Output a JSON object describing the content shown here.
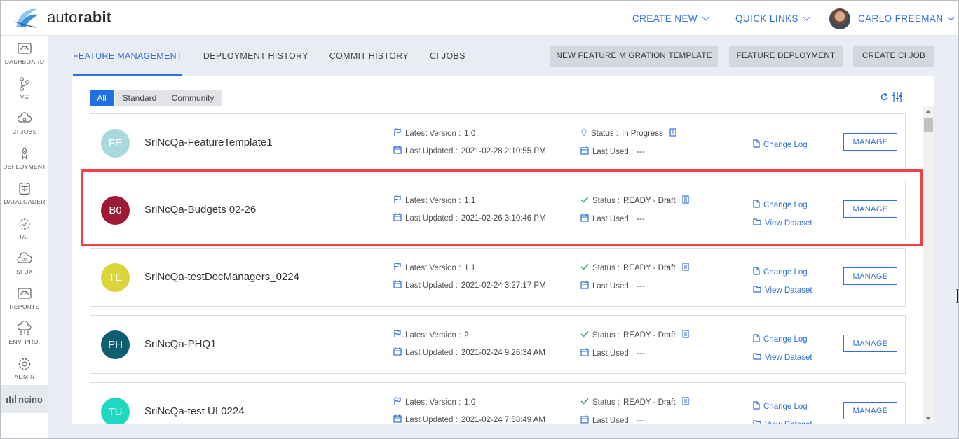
{
  "brand": {
    "prefix": "auto",
    "suffix": "rabit"
  },
  "header": {
    "create_new": "CREATE NEW",
    "quick_links": "QUICK LINKS",
    "user_name": "CARLO FREEMAN"
  },
  "sidebar": {
    "items": [
      {
        "label": "DASHBOARD",
        "icon": "dashboard-icon"
      },
      {
        "label": "VC",
        "icon": "vc-icon"
      },
      {
        "label": "CI JOBS",
        "icon": "ci-jobs-icon"
      },
      {
        "label": "DEPLOYMENT",
        "icon": "deployment-icon"
      },
      {
        "label": "DATALOADER",
        "icon": "dataloader-icon"
      },
      {
        "label": "TAF",
        "icon": "taf-icon"
      },
      {
        "label": "SFDX",
        "icon": "sfdx-icon"
      },
      {
        "label": "REPORTS",
        "icon": "reports-icon"
      },
      {
        "label": "ENV. PRO.",
        "icon": "env-pro-icon"
      },
      {
        "label": "ADMIN",
        "icon": "admin-icon"
      }
    ],
    "footer_logo": "ncino"
  },
  "tabs": [
    "FEATURE MANAGEMENT",
    "DEPLOYMENT HISTORY",
    "COMMIT HISTORY",
    "CI JOBS"
  ],
  "actions": {
    "new_template": "NEW FEATURE MIGRATION TEMPLATE",
    "feature_deployment": "FEATURE DEPLOYMENT",
    "create_ci_job": "CREATE CI JOB"
  },
  "filters": [
    "All",
    "Standard",
    "Community"
  ],
  "labels": {
    "latest_version": "Latest Version :",
    "last_updated": "Last Updated :",
    "status": "Status :",
    "last_used": "Last Used :",
    "change_log": "Change Log",
    "view_dataset": "View Dataset",
    "manage": "MANAGE"
  },
  "features": [
    {
      "initials": "FE",
      "color": "#a9d9dc",
      "name": "SriNcQa-FeatureTemplate1",
      "version": "1.0",
      "updated": "2021-02-28 2:10:55 PM",
      "status": "In Progress",
      "last_used": "---",
      "has_dataset": false
    },
    {
      "initials": "B0",
      "color": "#9c1a33",
      "name": "SriNcQa-Budgets 02-26",
      "version": "1.1",
      "updated": "2021-02-26 3:10:46 PM",
      "status": "READY - Draft",
      "last_used": "---",
      "has_dataset": true
    },
    {
      "initials": "TE",
      "color": "#dcd43b",
      "name": "SriNcQa-testDocManagers_0224",
      "version": "1.1",
      "updated": "2021-02-24 3:27:17 PM",
      "status": "READY - Draft",
      "last_used": "---",
      "has_dataset": true
    },
    {
      "initials": "PH",
      "color": "#0d5e70",
      "name": "SriNcQa-PHQ1",
      "version": "2",
      "updated": "2021-02-24 9:26:34 AM",
      "status": "READY - Draft",
      "last_used": "---",
      "has_dataset": true
    },
    {
      "initials": "TU",
      "color": "#20d7c0",
      "name": "SriNcQa-test UI 0224",
      "version": "1.0",
      "updated": "2021-02-24 7:58:49 AM",
      "status": "READY - Draft",
      "last_used": "---",
      "has_dataset": true
    }
  ]
}
